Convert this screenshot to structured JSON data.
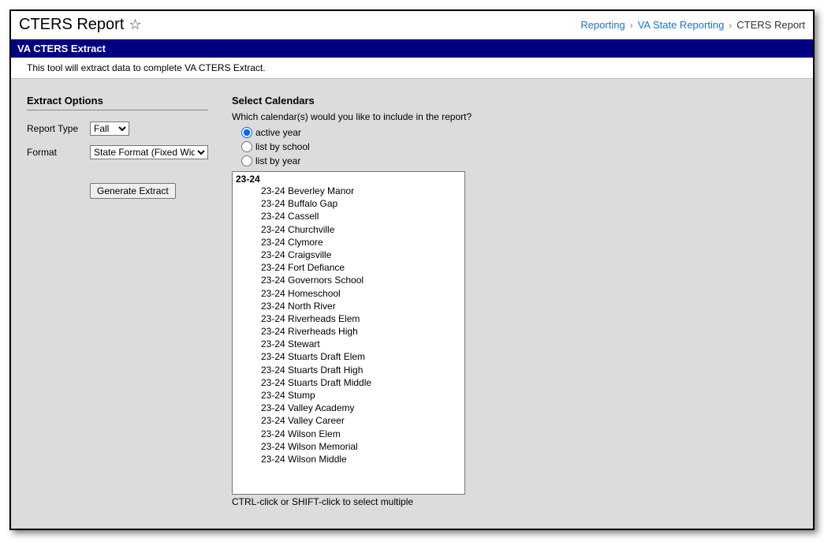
{
  "header": {
    "title": "CTERS Report",
    "breadcrumb": {
      "link1": "Reporting",
      "link2": "VA State Reporting",
      "current": "CTERS Report"
    }
  },
  "blue_bar": "VA CTERS Extract",
  "description": "This tool will extract data to complete VA CTERS Extract.",
  "extract_options": {
    "heading": "Extract Options",
    "report_type_label": "Report Type",
    "report_type_value": "Fall",
    "format_label": "Format",
    "format_value": "State Format (Fixed Width)",
    "generate_label": "Generate Extract"
  },
  "calendars": {
    "heading": "Select Calendars",
    "prompt": "Which calendar(s) would you like to include in the report?",
    "radio_active": "active year",
    "radio_school": "list by school",
    "radio_year": "list by year",
    "year_header": "23-24",
    "items": [
      "23-24 Beverley Manor",
      "23-24 Buffalo Gap",
      "23-24 Cassell",
      "23-24 Churchville",
      "23-24 Clymore",
      "23-24 Craigsville",
      "23-24 Fort Defiance",
      "23-24 Governors School",
      "23-24 Homeschool",
      "23-24 North River",
      "23-24 Riverheads Elem",
      "23-24 Riverheads High",
      "23-24 Stewart",
      "23-24 Stuarts Draft Elem",
      "23-24 Stuarts Draft High",
      "23-24 Stuarts Draft Middle",
      "23-24 Stump",
      "23-24 Valley Academy",
      "23-24 Valley Career",
      "23-24 Wilson Elem",
      "23-24 Wilson Memorial",
      "23-24 Wilson Middle"
    ],
    "hint": "CTRL-click or SHIFT-click to select multiple"
  }
}
